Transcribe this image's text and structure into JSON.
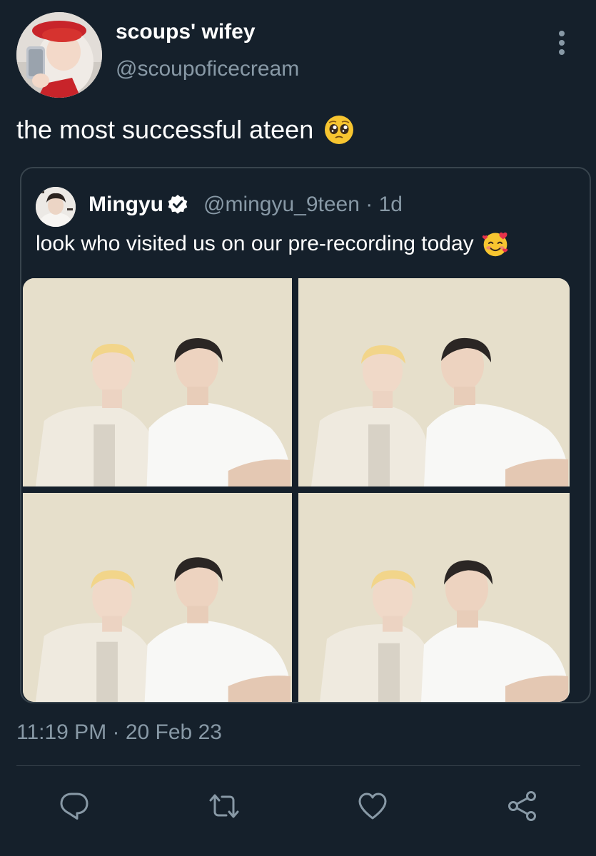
{
  "colors": {
    "background": "#15202b",
    "text_primary": "#ffffff",
    "text_secondary": "#8899a6",
    "border": "#38444d",
    "verified_badge": "#ffffff"
  },
  "author": {
    "display_name": "scoups' wifey",
    "handle": "@scoupoficecream",
    "avatar_icon": "user-avatar"
  },
  "more_icon": "more-vertical-icon",
  "tweet": {
    "text": "the most successful ateen",
    "emoji": "pleading-face"
  },
  "quoted": {
    "display_name": "Mingyu",
    "verified_icon": "verified-badge-icon",
    "handle_time": "@mingyu_9teen · 1d",
    "text": "look who visited us on our pre-recording today",
    "emoji": "smiling-face-with-hearts",
    "photos": [
      "photo-1",
      "photo-2",
      "photo-3",
      "photo-4"
    ]
  },
  "timestamp": "11:19 PM · 20 Feb 23",
  "actions": [
    {
      "name": "reply",
      "icon": "reply-icon"
    },
    {
      "name": "retweet",
      "icon": "retweet-icon"
    },
    {
      "name": "like",
      "icon": "heart-icon"
    },
    {
      "name": "share",
      "icon": "share-icon"
    }
  ]
}
